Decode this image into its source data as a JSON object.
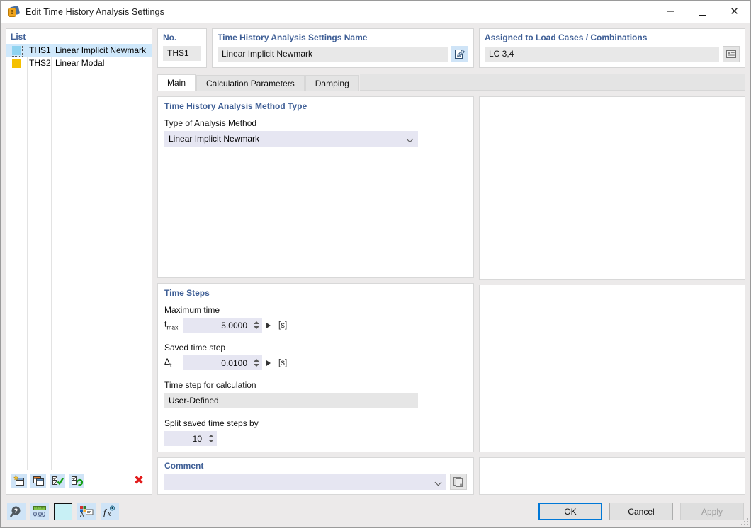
{
  "window": {
    "title": "Edit Time History Analysis Settings",
    "app_icon": "lock-orange-icon",
    "minimize_label": "Minimize",
    "maximize_label": "Maximize",
    "close_label": "Close"
  },
  "list": {
    "header": "List",
    "columns": [
      "color",
      "no",
      "name"
    ],
    "rows": [
      {
        "color": "#8fd3f0",
        "no": "THS1",
        "name": "Linear Implicit Newmark",
        "selected": true
      },
      {
        "color": "#f5c000",
        "no": "THS2",
        "name": "Linear Modal",
        "selected": false
      }
    ],
    "toolbar": [
      {
        "name": "new-item-button",
        "icon": "new-window-icon"
      },
      {
        "name": "copy-item-button",
        "icon": "copy-windows-icon"
      },
      {
        "name": "select-all-button",
        "icon": "checklist-check-icon"
      },
      {
        "name": "refresh-selection-button",
        "icon": "checklist-refresh-icon"
      },
      {
        "name": "delete-item-button",
        "icon": "red-x-icon"
      }
    ]
  },
  "fields": {
    "no_caption": "No.",
    "no_value": "THS1",
    "name_caption": "Time History Analysis Settings Name",
    "name_value": "Linear Implicit Newmark",
    "name_edit_icon": "edit-pencil-icon",
    "assigned_caption": "Assigned to Load Cases / Combinations",
    "assigned_value": "LC 3,4",
    "assigned_icon": "load-case-list-icon"
  },
  "tabs": [
    {
      "label": "Main",
      "active": true
    },
    {
      "label": "Calculation Parameters",
      "active": false
    },
    {
      "label": "Damping",
      "active": false
    }
  ],
  "method_section": {
    "title": "Time History Analysis Method Type",
    "label": "Type of Analysis Method",
    "value": "Linear Implicit Newmark",
    "dropdown_icon": "chevron-down-icon"
  },
  "time_steps": {
    "title": "Time Steps",
    "max_time_label": "Maximum time",
    "max_time_symbol": "t",
    "max_time_symbol_sub": "max",
    "max_time_value": "5.0000",
    "max_time_unit": "[s]",
    "saved_step_label": "Saved time step",
    "saved_step_symbol": "Δ",
    "saved_step_symbol_sub": "t",
    "saved_step_value": "0.0100",
    "saved_step_unit": "[s]",
    "calc_step_label": "Time step for calculation",
    "calc_step_value": "User-Defined",
    "split_label": "Split saved time steps by",
    "split_value": "10"
  },
  "comment": {
    "title": "Comment",
    "value": "",
    "dropdown_icon": "chevron-down-icon",
    "copy_icon": "copy-pages-icon"
  },
  "footer": {
    "icons": [
      {
        "name": "help-button",
        "icon": "question-magnifier-icon"
      },
      {
        "name": "units-button",
        "icon": "ruler-number-icon"
      },
      {
        "name": "color-swatch-button",
        "icon": "color-swatch-icon",
        "color": "#c8f0f5"
      },
      {
        "name": "display-properties-button",
        "icon": "display-properties-icon"
      },
      {
        "name": "formula-button",
        "icon": "function-fx-icon"
      }
    ],
    "ok_label": "OK",
    "cancel_label": "Cancel",
    "apply_label": "Apply",
    "apply_enabled": false
  },
  "colors": {
    "accent_caption": "#3f5f96",
    "selection": "#cfe8fb",
    "field_lilac": "#e6e6f2",
    "field_grey": "#e8e8e8",
    "default_button_border": "#0078d7",
    "delete_red": "#e21b1b"
  }
}
